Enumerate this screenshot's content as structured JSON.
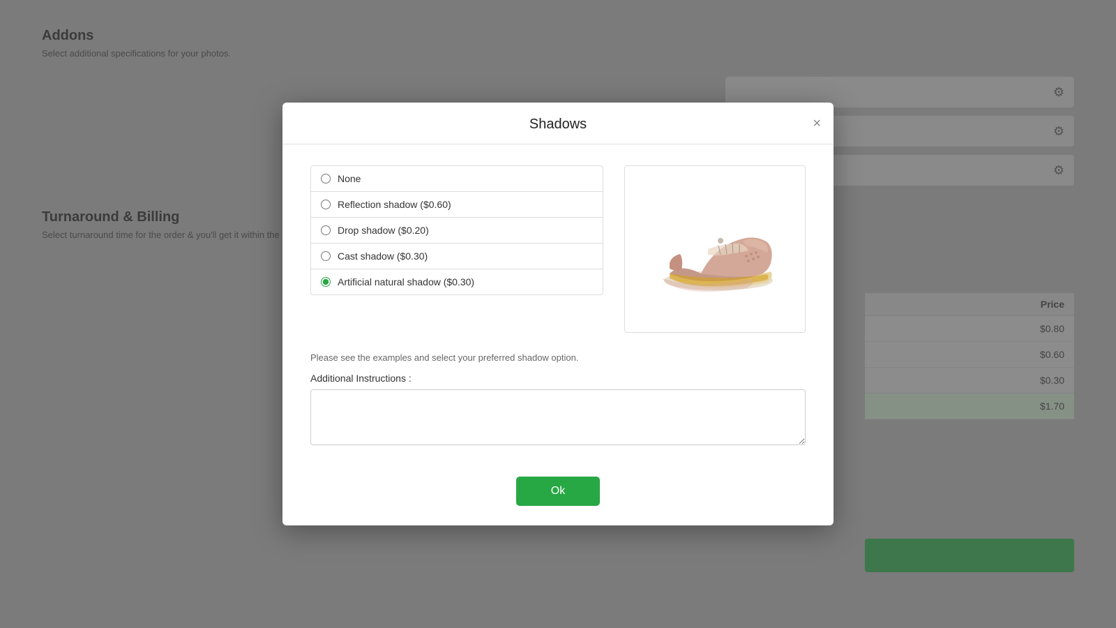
{
  "background": {
    "section1": {
      "title": "Addons",
      "description": "Select additional specifications for your photos."
    },
    "section2": {
      "title": "Turnaround & Billing",
      "description": "Select turnaround time for the order & you'll get it within the selecting longer turnaround time."
    },
    "table": {
      "price_header": "Price",
      "rows": [
        {
          "price": "$0.80"
        },
        {
          "price": "$0.60"
        },
        {
          "price": "$0.30"
        },
        {
          "price": "$1.70",
          "highlighted": true
        }
      ]
    }
  },
  "modal": {
    "title": "Shadows",
    "close_label": "×",
    "options": [
      {
        "id": "none",
        "label": "None",
        "checked": false
      },
      {
        "id": "reflection",
        "label": "Reflection shadow ($0.60)",
        "checked": false
      },
      {
        "id": "drop",
        "label": "Drop shadow ($0.20)",
        "checked": false
      },
      {
        "id": "cast",
        "label": "Cast shadow ($0.30)",
        "checked": false
      },
      {
        "id": "artificial",
        "label": "Artificial natural shadow ($0.30)",
        "checked": true
      }
    ],
    "info_text": "Please see the examples and select your preferred shadow option.",
    "additional_label": "Additional Instructions :",
    "textarea_placeholder": "",
    "ok_button_label": "Ok"
  }
}
